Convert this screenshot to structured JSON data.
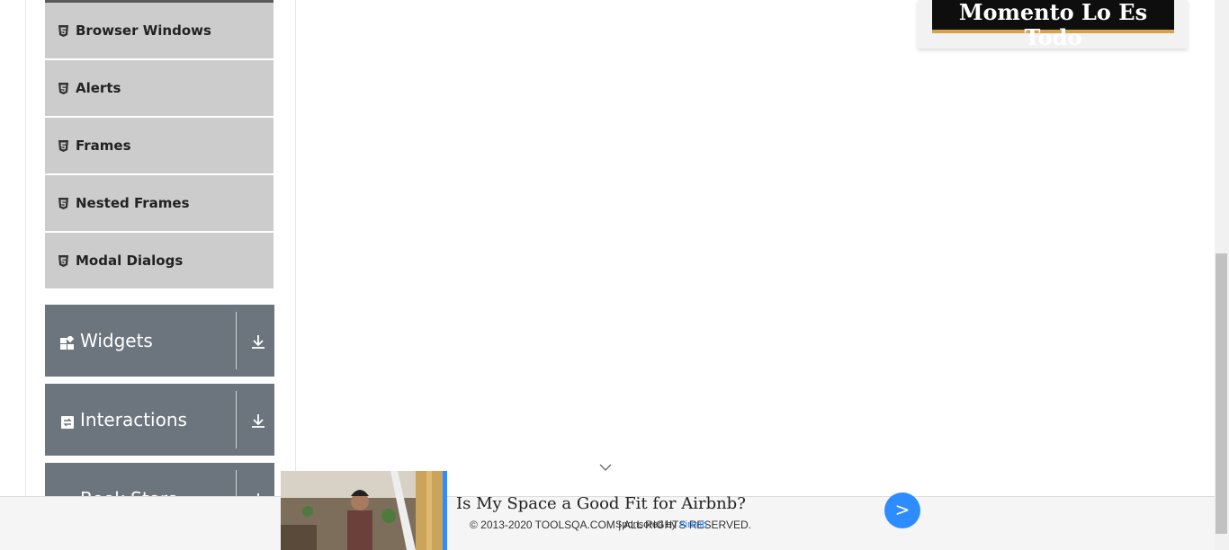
{
  "sidebar": {
    "sub_items": [
      {
        "label": "Browser Windows",
        "icon": "html5-icon"
      },
      {
        "label": "Alerts",
        "icon": "html5-icon"
      },
      {
        "label": "Frames",
        "icon": "html5-icon"
      },
      {
        "label": "Nested Frames",
        "icon": "html5-icon"
      },
      {
        "label": "Modal Dialogs",
        "icon": "html5-icon"
      }
    ],
    "groups": [
      {
        "label": "Widgets",
        "icon": "widgets-icon"
      },
      {
        "label": "Interactions",
        "icon": "interactions-icon"
      },
      {
        "label": "Book Store",
        "icon": "book-store-icon"
      }
    ]
  },
  "top_ad": {
    "text": "Momento Lo Es Todo"
  },
  "footer": {
    "copyright": "© 2013-2020 TOOLSQA.COM | ALL RIGHTS RESERVED."
  },
  "sponsored_ad": {
    "title": "Is My Space a Good Fit for Airbnb?",
    "sponsored_prefix": "Sponsored by ",
    "sponsor_brand": "Airbnb",
    "cta": ">"
  },
  "colors": {
    "group_bg": "#6c757d",
    "sub_item_bg": "#cccccc",
    "accent": "#2d8cff"
  }
}
